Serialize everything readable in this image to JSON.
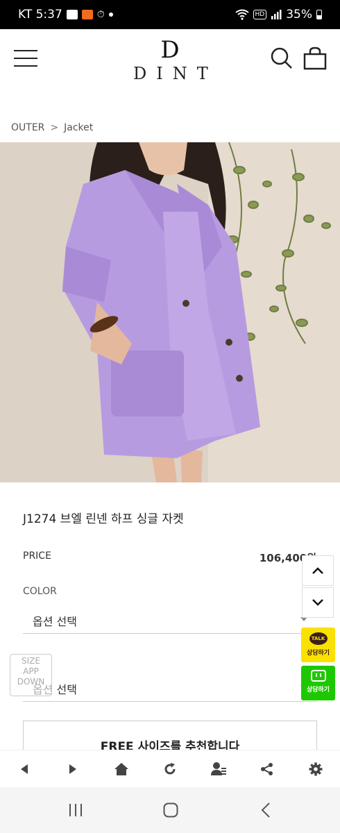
{
  "status_bar": {
    "carrier_time": "KT 5:37",
    "battery": "35%",
    "hd_badge": "HD"
  },
  "header": {
    "logo_mark": "D",
    "logo_text": "DINT"
  },
  "breadcrumb": {
    "category": "OUTER",
    "separator": ">",
    "subcategory": "Jacket"
  },
  "product": {
    "name": "J1274 브엘 린넨 하프 싱글 자켓",
    "price_label": "PRICE",
    "price_value": "106,400원",
    "color_label": "COLOR",
    "color_select": "옵션 선택",
    "size_select": "옵션 선택"
  },
  "size_app": {
    "line1": "SIZE",
    "line2": "APP",
    "line3": "DOWN"
  },
  "recommend": {
    "title": "FREE 사이즈를 추천합니다"
  },
  "side_buttons": {
    "talk_bubble": "TALK",
    "talk_label": "상담하기",
    "chat_label": "상담하기"
  },
  "colors": {
    "hero_bg": "#ddd2c6",
    "jacket": "#b79be0",
    "kakao": "#fae100",
    "naver": "#1ec800"
  }
}
